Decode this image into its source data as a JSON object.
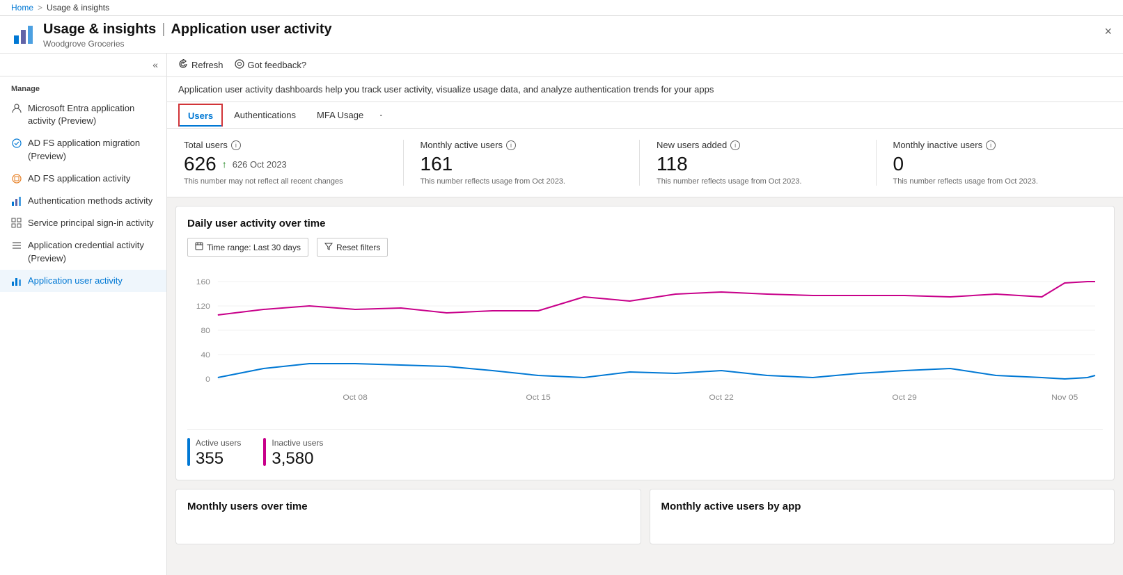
{
  "breadcrumb": {
    "home": "Home",
    "current": "Usage & insights",
    "separator": ">"
  },
  "header": {
    "icon_alt": "usage-insights-icon",
    "title_prefix": "Usage & insights",
    "title_separator": "|",
    "title_suffix": "Application user activity",
    "subtitle": "Woodgrove Groceries",
    "close_label": "×"
  },
  "sidebar": {
    "manage_label": "Manage",
    "collapse_icon": "«",
    "items": [
      {
        "id": "entra-app-activity",
        "label": "Microsoft Entra application activity (Preview)",
        "icon": "person-icon",
        "active": false
      },
      {
        "id": "adfs-migration",
        "label": "AD FS application migration (Preview)",
        "icon": "adfs-icon",
        "active": false
      },
      {
        "id": "adfs-app-activity",
        "label": "AD FS application activity",
        "icon": "adfs2-icon",
        "active": false
      },
      {
        "id": "auth-methods-activity",
        "label": "Authentication methods activity",
        "icon": "chart-icon",
        "active": false
      },
      {
        "id": "service-principal-signin",
        "label": "Service principal sign-in activity",
        "icon": "grid-icon",
        "active": false
      },
      {
        "id": "app-credential",
        "label": "Application credential activity (Preview)",
        "icon": "lines-icon",
        "active": false
      },
      {
        "id": "app-user-activity",
        "label": "Application user activity",
        "icon": "chart2-icon",
        "active": true
      }
    ]
  },
  "toolbar": {
    "refresh_label": "Refresh",
    "feedback_label": "Got feedback?",
    "refresh_icon": "refresh-icon",
    "feedback_icon": "feedback-icon"
  },
  "description": "Application user activity dashboards help you track user activity, visualize usage data, and analyze authentication trends for your apps",
  "tabs": [
    {
      "id": "users",
      "label": "Users",
      "active": true,
      "highlight": true
    },
    {
      "id": "authentications",
      "label": "Authentications",
      "active": false
    },
    {
      "id": "mfa-usage",
      "label": "MFA Usage",
      "active": false
    }
  ],
  "tabs_more": "·",
  "stats": [
    {
      "id": "total-users",
      "label": "Total users",
      "value": "626",
      "change": "626 Oct 2023",
      "has_arrow": true,
      "note": "This number may not reflect all recent changes"
    },
    {
      "id": "monthly-active-users",
      "label": "Monthly active users",
      "value": "161",
      "change": "",
      "has_arrow": false,
      "note": "This number reflects usage from Oct 2023."
    },
    {
      "id": "new-users-added",
      "label": "New users added",
      "value": "118",
      "change": "",
      "has_arrow": false,
      "note": "This number reflects usage from Oct 2023."
    },
    {
      "id": "monthly-inactive-users",
      "label": "Monthly inactive users",
      "value": "0",
      "change": "",
      "has_arrow": false,
      "note": "This number reflects usage from Oct 2023."
    }
  ],
  "chart": {
    "title": "Daily user activity over time",
    "time_range_label": "Time range: Last 30 days",
    "reset_filters_label": "Reset filters",
    "reset_icon": "filter-icon",
    "x_labels": [
      "Oct 08",
      "Oct 15",
      "Oct 22",
      "Oct 29",
      "Nov 05"
    ],
    "y_labels": [
      "160",
      "120",
      "80",
      "40",
      "0"
    ],
    "active_color": "#0078d4",
    "inactive_color": "#c8008a"
  },
  "legend": {
    "active_label": "Active users",
    "active_value": "355",
    "active_color": "#0078d4",
    "inactive_label": "Inactive users",
    "inactive_value": "3,580",
    "inactive_color": "#c8008a"
  },
  "bottom_cards": [
    {
      "id": "monthly-users-over-time",
      "title": "Monthly users over time"
    },
    {
      "id": "monthly-active-users-by-app",
      "title": "Monthly active users by app"
    }
  ]
}
